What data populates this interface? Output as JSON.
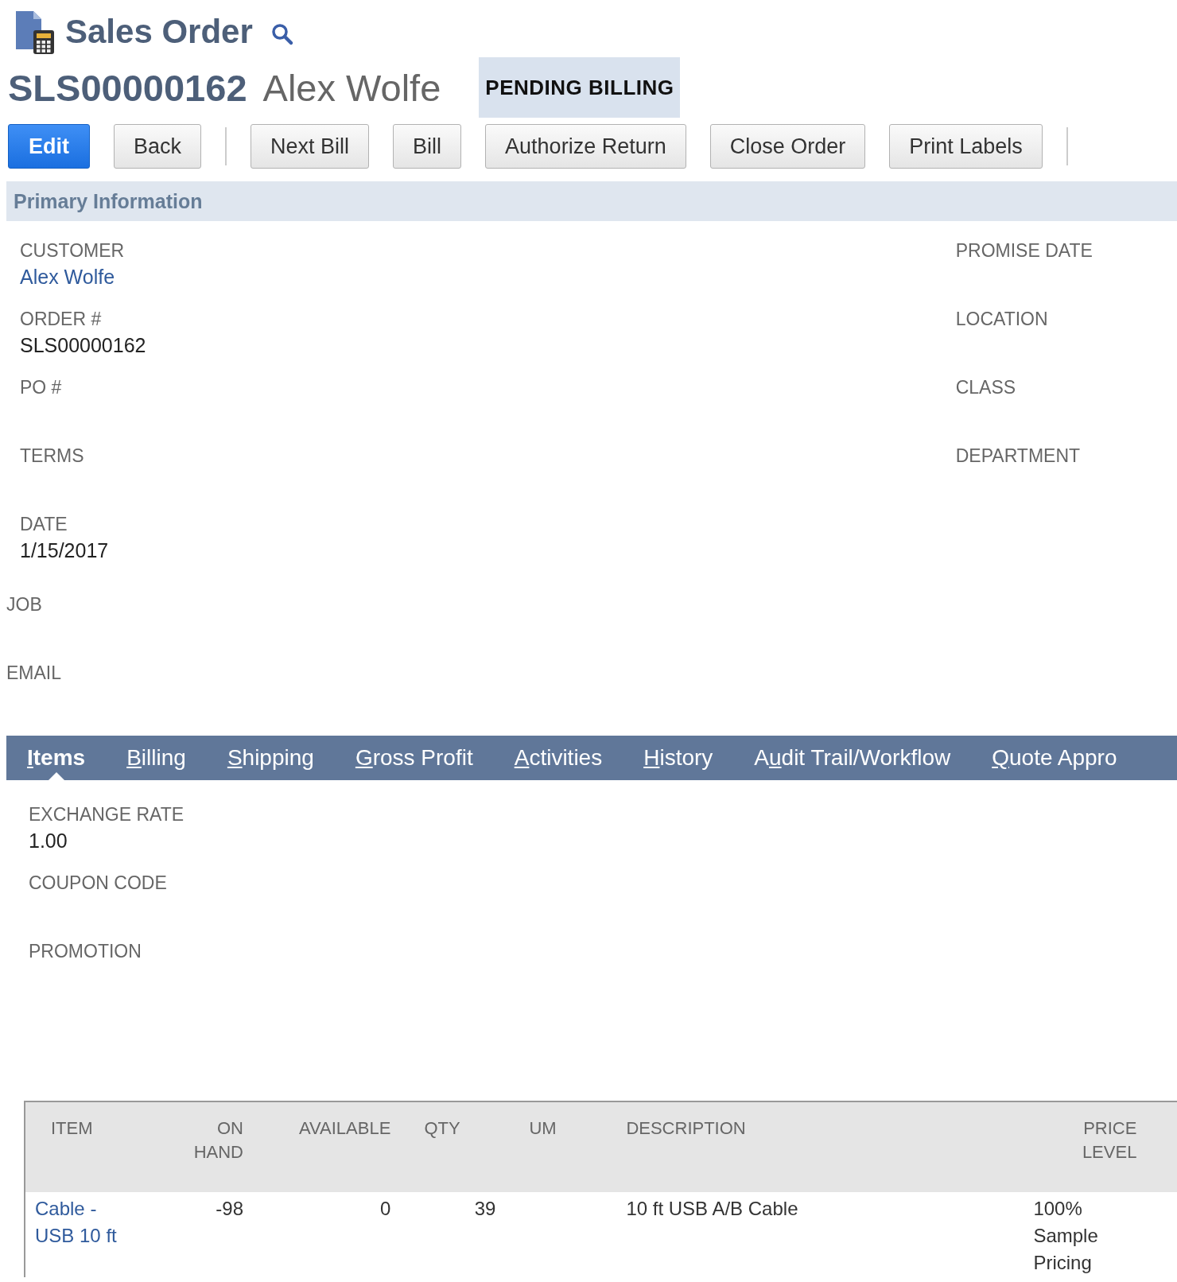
{
  "page": {
    "title": "Sales Order",
    "record_number": "SLS00000162",
    "record_name": "Alex Wolfe",
    "status": "PENDING BILLING"
  },
  "buttons": [
    {
      "label": "Edit",
      "primary": true
    },
    {
      "label": "Back",
      "primary": false
    },
    {
      "label": "Next Bill",
      "primary": false
    },
    {
      "label": "Bill",
      "primary": false
    },
    {
      "label": "Authorize Return",
      "primary": false
    },
    {
      "label": "Close Order",
      "primary": false
    },
    {
      "label": "Print Labels",
      "primary": false
    }
  ],
  "primary_information": {
    "title": "Primary Information",
    "left_fields": [
      {
        "label": "CUSTOMER",
        "value": "Alex Wolfe",
        "link": true
      },
      {
        "label": "ORDER #",
        "value": "SLS00000162",
        "link": false
      },
      {
        "label": "PO #"
      },
      {
        "label": "TERMS"
      },
      {
        "label": "DATE",
        "value": "1/15/2017",
        "link": false
      }
    ],
    "right_fields": [
      {
        "label": "PROMISE DATE"
      },
      {
        "label": "LOCATION"
      },
      {
        "label": "CLASS"
      },
      {
        "label": "DEPARTMENT"
      }
    ],
    "outer_fields": [
      {
        "label": "JOB"
      },
      {
        "label": "EMAIL"
      }
    ]
  },
  "tabs": [
    {
      "access_key": "I",
      "label_rest": "tems",
      "selected": true
    },
    {
      "access_key": "B",
      "label_rest": "illing",
      "selected": false
    },
    {
      "access_key": "S",
      "label_rest": "hipping",
      "selected": false
    },
    {
      "access_key": "G",
      "label_rest": "ross Profit",
      "selected": false
    },
    {
      "access_key": "A",
      "label_rest": "ctivities",
      "selected": false
    },
    {
      "access_key": "H",
      "label_rest": "istory",
      "selected": false
    },
    {
      "label_start": "A",
      "access_key": "u",
      "label_rest": "dit Trail/Workflow",
      "selected": false
    },
    {
      "access_key": "Q",
      "label_rest": "uote Appro",
      "selected": false
    }
  ],
  "items_fields": [
    {
      "label": "EXCHANGE RATE",
      "value": "1.00"
    },
    {
      "label": "COUPON CODE"
    },
    {
      "label": "PROMOTION"
    }
  ],
  "table": {
    "columns": [
      "ITEM",
      "ON HAND",
      "AVAILABLE",
      "QTY",
      "UM",
      "DESCRIPTION",
      "PRICE LEVEL"
    ],
    "rows": [
      {
        "cells": [
          "Cable - USB 10 ft",
          "-98",
          "0",
          "39",
          "",
          "10 ft USB A/B Cable",
          "100% Sample Pricing"
        ]
      }
    ]
  }
}
